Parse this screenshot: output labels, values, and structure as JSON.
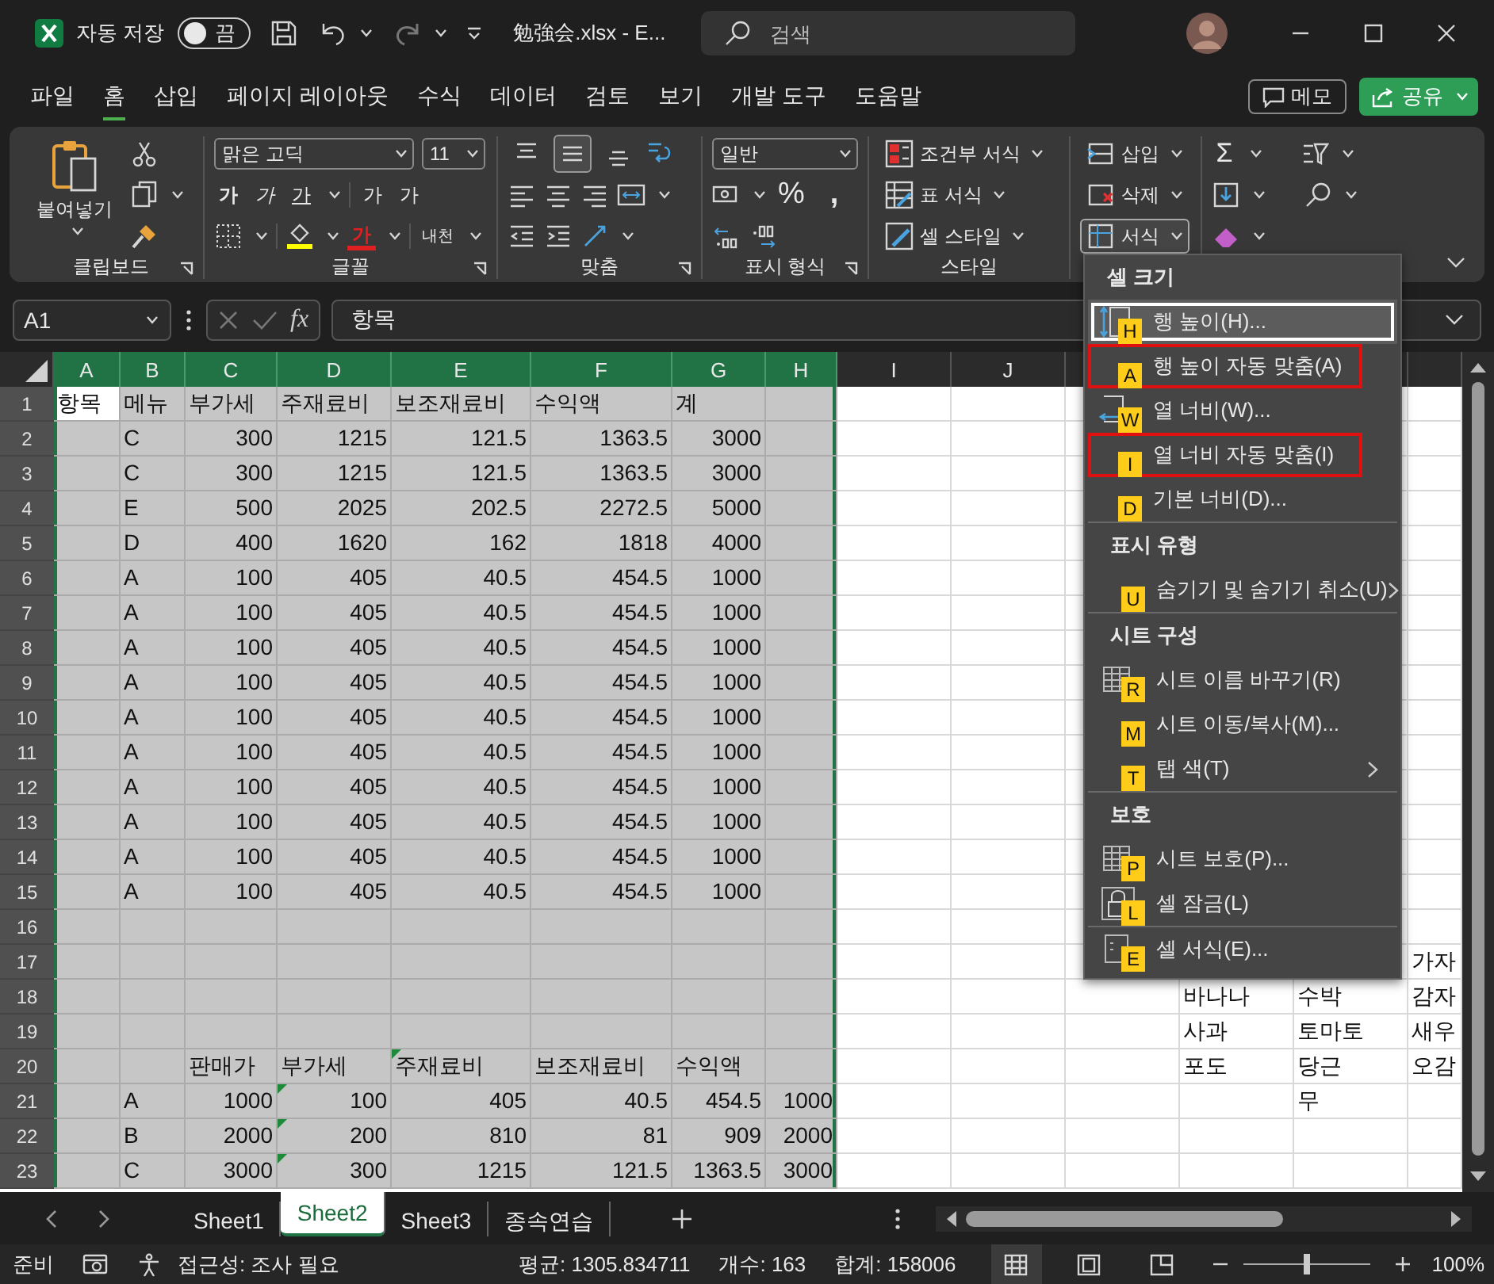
{
  "title_bar": {
    "autosave_label": "자동 저장",
    "autosave_toggle": {
      "label": "끔",
      "on": false
    },
    "file_title": "勉強会.xlsx  -  E...",
    "search": {
      "placeholder": "검색"
    }
  },
  "ribbon_tabs": [
    {
      "label": "파일",
      "selected": false
    },
    {
      "label": "홈",
      "selected": true
    },
    {
      "label": "삽입",
      "selected": false
    },
    {
      "label": "페이지 레이아웃",
      "selected": false
    },
    {
      "label": "수식",
      "selected": false
    },
    {
      "label": "데이터",
      "selected": false
    },
    {
      "label": "검토",
      "selected": false
    },
    {
      "label": "보기",
      "selected": false
    },
    {
      "label": "개발 도구",
      "selected": false
    },
    {
      "label": "도움말",
      "selected": false
    }
  ],
  "comments_button": "메모",
  "share_button": "공유",
  "ribbon": {
    "clipboard": {
      "paste": "붙여넣기",
      "label": "클립보드"
    },
    "font": {
      "font_name": "맑은 고딕",
      "font_size": "11",
      "bold": "가",
      "italic": "가",
      "underline": "가",
      "grow": "가",
      "shrink": "가",
      "font_color": "가",
      "phonetic": "내천",
      "label": "글꼴"
    },
    "alignment": {
      "vertical": [
        {
          "selected": false
        },
        {
          "selected": true
        },
        {
          "selected": false
        }
      ],
      "label": "맞춤"
    },
    "number": {
      "format": "일반",
      "percent": "%",
      "comma": ",",
      "label": "표시 형식"
    },
    "styles": {
      "items": [
        "조건부 서식",
        "표 서식",
        "셀 스타일"
      ],
      "label": "스타일"
    },
    "cells": {
      "items": [
        {
          "label": "삽입",
          "selected": false
        },
        {
          "label": "삭제",
          "selected": false
        },
        {
          "label": "서식",
          "selected": true
        }
      ]
    },
    "editing": {
      "autosum": "Σ"
    }
  },
  "formula_bar": {
    "name_box": "A1",
    "fx": "fx",
    "value": "항목"
  },
  "sheet": {
    "columns": [
      {
        "label": "A",
        "selected": true
      },
      {
        "label": "B",
        "selected": true
      },
      {
        "label": "C",
        "selected": true
      },
      {
        "label": "D",
        "selected": true
      },
      {
        "label": "E",
        "selected": true
      },
      {
        "label": "F",
        "selected": true
      },
      {
        "label": "G",
        "selected": true
      },
      {
        "label": "H",
        "selected": true
      },
      {
        "label": "I",
        "selected": false
      },
      {
        "label": "J",
        "selected": false
      }
    ],
    "rows": [
      {
        "label": "1",
        "selected": true,
        "cells": [
          {
            "kind": "text",
            "text": "항목",
            "active": true
          },
          {
            "kind": "text",
            "text": "메뉴"
          },
          {
            "kind": "text",
            "text": "부가세"
          },
          {
            "kind": "text",
            "text": "주재료비"
          },
          {
            "kind": "text",
            "text": "보조재료비"
          },
          {
            "kind": "text",
            "text": "수익액"
          },
          {
            "kind": "text",
            "text": "계"
          }
        ]
      },
      {
        "label": "2",
        "selected": true,
        "cells": [
          {
            "kind": "empty"
          },
          {
            "kind": "text",
            "text": "C"
          },
          {
            "kind": "number",
            "text": "300"
          },
          {
            "kind": "number",
            "text": "1215"
          },
          {
            "kind": "number",
            "text": "121.5"
          },
          {
            "kind": "number",
            "text": "1363.5"
          },
          {
            "kind": "number",
            "text": "3000"
          }
        ]
      },
      {
        "label": "3",
        "selected": true,
        "cells": [
          {
            "kind": "empty"
          },
          {
            "kind": "text",
            "text": "C"
          },
          {
            "kind": "number",
            "text": "300"
          },
          {
            "kind": "number",
            "text": "1215"
          },
          {
            "kind": "number",
            "text": "121.5"
          },
          {
            "kind": "number",
            "text": "1363.5"
          },
          {
            "kind": "number",
            "text": "3000"
          }
        ]
      },
      {
        "label": "4",
        "selected": true,
        "cells": [
          {
            "kind": "empty"
          },
          {
            "kind": "text",
            "text": "E"
          },
          {
            "kind": "number",
            "text": "500"
          },
          {
            "kind": "number",
            "text": "2025"
          },
          {
            "kind": "number",
            "text": "202.5"
          },
          {
            "kind": "number",
            "text": "2272.5"
          },
          {
            "kind": "number",
            "text": "5000"
          }
        ]
      },
      {
        "label": "5",
        "selected": true,
        "cells": [
          {
            "kind": "empty"
          },
          {
            "kind": "text",
            "text": "D"
          },
          {
            "kind": "number",
            "text": "400"
          },
          {
            "kind": "number",
            "text": "1620"
          },
          {
            "kind": "number",
            "text": "162"
          },
          {
            "kind": "number",
            "text": "1818"
          },
          {
            "kind": "number",
            "text": "4000"
          }
        ]
      },
      {
        "label": "6",
        "selected": true,
        "cells": [
          {
            "kind": "empty"
          },
          {
            "kind": "text",
            "text": "A"
          },
          {
            "kind": "number",
            "text": "100"
          },
          {
            "kind": "number",
            "text": "405"
          },
          {
            "kind": "number",
            "text": "40.5"
          },
          {
            "kind": "number",
            "text": "454.5"
          },
          {
            "kind": "number",
            "text": "1000"
          }
        ]
      },
      {
        "label": "7",
        "selected": true,
        "cells": [
          {
            "kind": "empty"
          },
          {
            "kind": "text",
            "text": "A"
          },
          {
            "kind": "number",
            "text": "100"
          },
          {
            "kind": "number",
            "text": "405"
          },
          {
            "kind": "number",
            "text": "40.5"
          },
          {
            "kind": "number",
            "text": "454.5"
          },
          {
            "kind": "number",
            "text": "1000"
          }
        ]
      },
      {
        "label": "8",
        "selected": true,
        "cells": [
          {
            "kind": "empty"
          },
          {
            "kind": "text",
            "text": "A"
          },
          {
            "kind": "number",
            "text": "100"
          },
          {
            "kind": "number",
            "text": "405"
          },
          {
            "kind": "number",
            "text": "40.5"
          },
          {
            "kind": "number",
            "text": "454.5"
          },
          {
            "kind": "number",
            "text": "1000"
          }
        ]
      },
      {
        "label": "9",
        "selected": true,
        "cells": [
          {
            "kind": "empty"
          },
          {
            "kind": "text",
            "text": "A"
          },
          {
            "kind": "number",
            "text": "100"
          },
          {
            "kind": "number",
            "text": "405"
          },
          {
            "kind": "number",
            "text": "40.5"
          },
          {
            "kind": "number",
            "text": "454.5"
          },
          {
            "kind": "number",
            "text": "1000"
          }
        ]
      },
      {
        "label": "10",
        "selected": true,
        "cells": [
          {
            "kind": "empty"
          },
          {
            "kind": "text",
            "text": "A"
          },
          {
            "kind": "number",
            "text": "100"
          },
          {
            "kind": "number",
            "text": "405"
          },
          {
            "kind": "number",
            "text": "40.5"
          },
          {
            "kind": "number",
            "text": "454.5"
          },
          {
            "kind": "number",
            "text": "1000"
          }
        ]
      },
      {
        "label": "11",
        "selected": true,
        "cells": [
          {
            "kind": "empty"
          },
          {
            "kind": "text",
            "text": "A"
          },
          {
            "kind": "number",
            "text": "100"
          },
          {
            "kind": "number",
            "text": "405"
          },
          {
            "kind": "number",
            "text": "40.5"
          },
          {
            "kind": "number",
            "text": "454.5"
          },
          {
            "kind": "number",
            "text": "1000"
          }
        ]
      },
      {
        "label": "12",
        "selected": true,
        "cells": [
          {
            "kind": "empty"
          },
          {
            "kind": "text",
            "text": "A"
          },
          {
            "kind": "number",
            "text": "100"
          },
          {
            "kind": "number",
            "text": "405"
          },
          {
            "kind": "number",
            "text": "40.5"
          },
          {
            "kind": "number",
            "text": "454.5"
          },
          {
            "kind": "number",
            "text": "1000"
          }
        ]
      },
      {
        "label": "13",
        "selected": true,
        "cells": [
          {
            "kind": "empty"
          },
          {
            "kind": "text",
            "text": "A"
          },
          {
            "kind": "number",
            "text": "100"
          },
          {
            "kind": "number",
            "text": "405"
          },
          {
            "kind": "number",
            "text": "40.5"
          },
          {
            "kind": "number",
            "text": "454.5"
          },
          {
            "kind": "number",
            "text": "1000"
          }
        ]
      },
      {
        "label": "14",
        "selected": true,
        "cells": [
          {
            "kind": "empty"
          },
          {
            "kind": "text",
            "text": "A"
          },
          {
            "kind": "number",
            "text": "100"
          },
          {
            "kind": "number",
            "text": "405"
          },
          {
            "kind": "number",
            "text": "40.5"
          },
          {
            "kind": "number",
            "text": "454.5"
          },
          {
            "kind": "number",
            "text": "1000"
          }
        ]
      },
      {
        "label": "15",
        "selected": true,
        "cells": [
          {
            "kind": "empty"
          },
          {
            "kind": "text",
            "text": "A"
          },
          {
            "kind": "number",
            "text": "100"
          },
          {
            "kind": "number",
            "text": "405"
          },
          {
            "kind": "number",
            "text": "40.5"
          },
          {
            "kind": "number",
            "text": "454.5"
          },
          {
            "kind": "number",
            "text": "1000"
          }
        ]
      },
      {
        "label": "16",
        "selected": true
      },
      {
        "label": "17",
        "selected": true,
        "cells": [
          {
            "kind": "empty"
          },
          {
            "kind": "empty"
          },
          {
            "kind": "empty"
          },
          {
            "kind": "empty"
          },
          {
            "kind": "empty"
          },
          {
            "kind": "empty"
          },
          {
            "kind": "empty"
          },
          {
            "kind": "empty"
          },
          {
            "kind": "empty"
          },
          {
            "kind": "empty"
          },
          {
            "kind": "empty"
          },
          {
            "kind": "empty"
          },
          {
            "kind": "empty"
          },
          {
            "kind": "text",
            "text": "가자"
          }
        ]
      },
      {
        "label": "18",
        "selected": true,
        "cells": [
          {
            "kind": "empty"
          },
          {
            "kind": "empty"
          },
          {
            "kind": "empty"
          },
          {
            "kind": "empty"
          },
          {
            "kind": "empty"
          },
          {
            "kind": "empty"
          },
          {
            "kind": "empty"
          },
          {
            "kind": "empty"
          },
          {
            "kind": "empty"
          },
          {
            "kind": "empty"
          },
          {
            "kind": "empty"
          },
          {
            "kind": "text",
            "text": "바나나"
          },
          {
            "kind": "text",
            "text": "수박"
          },
          {
            "kind": "text",
            "text": "감자"
          }
        ]
      },
      {
        "label": "19",
        "selected": true,
        "cells": [
          {
            "kind": "empty"
          },
          {
            "kind": "empty"
          },
          {
            "kind": "empty"
          },
          {
            "kind": "empty"
          },
          {
            "kind": "empty"
          },
          {
            "kind": "empty"
          },
          {
            "kind": "empty"
          },
          {
            "kind": "empty"
          },
          {
            "kind": "empty"
          },
          {
            "kind": "empty"
          },
          {
            "kind": "empty"
          },
          {
            "kind": "text",
            "text": "사과"
          },
          {
            "kind": "text",
            "text": "토마토"
          },
          {
            "kind": "text",
            "text": "새우"
          }
        ]
      },
      {
        "label": "20",
        "selected": true,
        "cells": [
          {
            "kind": "empty"
          },
          {
            "kind": "empty"
          },
          {
            "kind": "text",
            "text": "판매가"
          },
          {
            "kind": "text",
            "text": "부가세"
          },
          {
            "kind": "text",
            "text": "주재료비",
            "error_flag": true
          },
          {
            "kind": "text",
            "text": "보조재료비"
          },
          {
            "kind": "text",
            "text": "수익액"
          },
          {
            "kind": "empty"
          },
          {
            "kind": "empty"
          },
          {
            "kind": "empty"
          },
          {
            "kind": "empty"
          },
          {
            "kind": "text",
            "text": "포도"
          },
          {
            "kind": "text",
            "text": "당근"
          },
          {
            "kind": "text",
            "text": "오감"
          }
        ]
      },
      {
        "label": "21",
        "selected": true,
        "cells": [
          {
            "kind": "empty"
          },
          {
            "kind": "text",
            "text": "A"
          },
          {
            "kind": "number",
            "text": "1000"
          },
          {
            "kind": "number",
            "text": "100",
            "error_flag": true
          },
          {
            "kind": "number",
            "text": "405"
          },
          {
            "kind": "number",
            "text": "40.5"
          },
          {
            "kind": "number",
            "text": "454.5"
          },
          {
            "kind": "number",
            "text": "1000"
          },
          {
            "kind": "empty"
          },
          {
            "kind": "empty"
          },
          {
            "kind": "empty"
          },
          {
            "kind": "empty"
          },
          {
            "kind": "text",
            "text": "무"
          }
        ]
      },
      {
        "label": "22",
        "selected": true,
        "cells": [
          {
            "kind": "empty"
          },
          {
            "kind": "text",
            "text": "B"
          },
          {
            "kind": "number",
            "text": "2000"
          },
          {
            "kind": "number",
            "text": "200",
            "error_flag": true
          },
          {
            "kind": "number",
            "text": "810"
          },
          {
            "kind": "number",
            "text": "81"
          },
          {
            "kind": "number",
            "text": "909"
          },
          {
            "kind": "number",
            "text": "2000"
          }
        ]
      },
      {
        "label": "23",
        "selected": true,
        "cells": [
          {
            "kind": "empty"
          },
          {
            "kind": "text",
            "text": "C"
          },
          {
            "kind": "number",
            "text": "3000"
          },
          {
            "kind": "number",
            "text": "300",
            "error_flag": true
          },
          {
            "kind": "number",
            "text": "1215"
          },
          {
            "kind": "number",
            "text": "121.5"
          },
          {
            "kind": "number",
            "text": "1363.5"
          },
          {
            "kind": "number",
            "text": "3000"
          }
        ]
      }
    ]
  },
  "context_menu": {
    "sections": [
      {
        "heading": "셀 크기",
        "items": [
          {
            "label": "행 높이(H)...",
            "key": "H",
            "kind": "row-height",
            "selected": true,
            "marked": false,
            "submenu": false
          },
          {
            "label": "행 높이 자동 맞춤(A)",
            "key": "A",
            "selected": false,
            "marked": true,
            "submenu": false
          },
          {
            "label": "열 너비(W)...",
            "key": "W",
            "kind": "column-width",
            "selected": false,
            "marked": false,
            "submenu": false
          },
          {
            "label": "열 너비 자동 맞춤(I)",
            "key": "I",
            "selected": false,
            "marked": true,
            "submenu": false
          },
          {
            "label": "기본 너비(D)...",
            "key": "D",
            "selected": false,
            "marked": false,
            "submenu": false
          }
        ]
      },
      {
        "heading": "표시 유형",
        "items": [
          {
            "label": "숨기기 및 숨기기 취소(U)",
            "key": "U",
            "selected": false,
            "marked": false,
            "submenu": true
          }
        ]
      },
      {
        "heading": "시트 구성",
        "items": [
          {
            "label": "시트 이름 바꾸기(R)",
            "key": "R",
            "kind": "table",
            "selected": false,
            "marked": false,
            "submenu": false
          },
          {
            "label": "시트 이동/복사(M)...",
            "key": "M",
            "selected": false,
            "marked": false,
            "submenu": false
          },
          {
            "label": "탭 색(T)",
            "key": "T",
            "selected": false,
            "marked": false,
            "submenu": true
          }
        ]
      },
      {
        "heading": "보호",
        "items": [
          {
            "label": "시트 보호(P)...",
            "key": "P",
            "kind": "table",
            "selected": false,
            "marked": false,
            "submenu": false
          },
          {
            "label": "셀 잠금(L)",
            "key": "L",
            "kind": "lock",
            "selected": false,
            "marked": false,
            "submenu": false
          }
        ]
      },
      {
        "items": [
          {
            "label": "셀 서식(E)...",
            "key": "E",
            "kind": "format",
            "selected": false,
            "marked": false,
            "submenu": false
          }
        ]
      }
    ]
  },
  "sheet_tabs": [
    {
      "label": "Sheet1",
      "selected": false
    },
    {
      "label": "Sheet2",
      "selected": true
    },
    {
      "label": "Sheet3",
      "selected": false
    },
    {
      "label": "종속연습",
      "selected": false
    }
  ],
  "status_bar": {
    "mode": "준비",
    "accessibility": "접근성: 조사 필요",
    "average": "평균: 1305.834711",
    "count": "개수: 163",
    "sum": "합계: 158006",
    "views": [
      {
        "selected": true
      },
      {
        "selected": false
      },
      {
        "selected": false
      }
    ],
    "zoom": {
      "level": 0.5,
      "reading": "100%"
    }
  }
}
